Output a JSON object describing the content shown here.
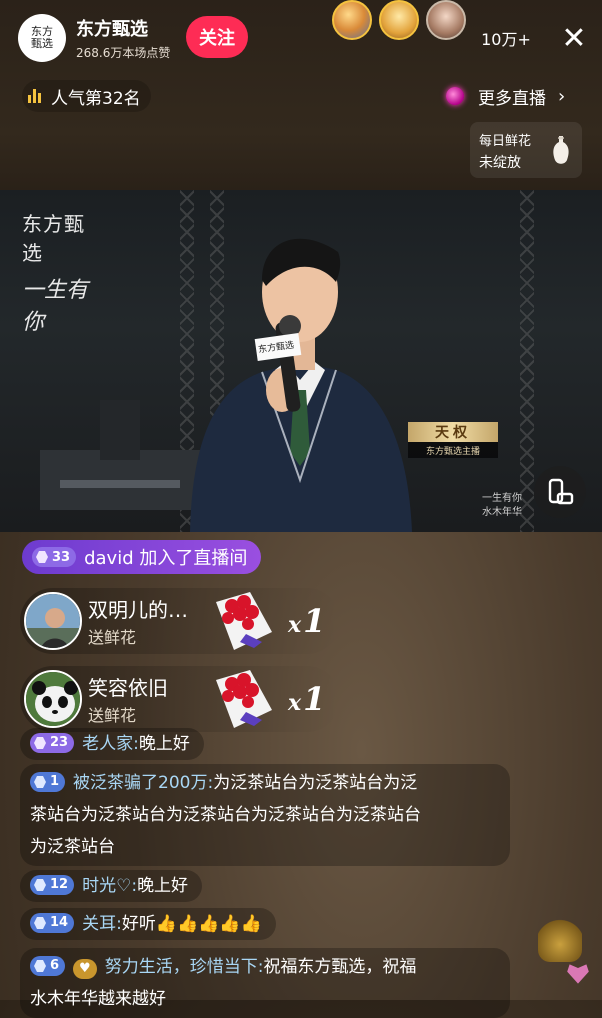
{
  "host": {
    "avatar_text": "东方\n甄选",
    "name": "东方甄选",
    "likes": "268.6万本场点赞",
    "follow_label": "关注"
  },
  "viewers": {
    "count": "10万+"
  },
  "close": {
    "glyph": "✕"
  },
  "popularity": {
    "rank_label": "人气第32名"
  },
  "more_live": {
    "label": "更多直播",
    "chevron": "›"
  },
  "flower_card": {
    "line1": "每日鲜花",
    "line2": "未绽放"
  },
  "video": {
    "logo_brand": "东方甄选",
    "logo_slogan": "一生有你",
    "mic_logo": "东方甄选",
    "nameplate_name": "天权",
    "nameplate_sub": "东方甄选主播",
    "watermark_line1": "一生有你",
    "watermark_line2": "水木年华"
  },
  "join": {
    "level": "33",
    "text": "david 加入了直播间"
  },
  "gifts": [
    {
      "user": "双明儿的…",
      "action": "送鲜花",
      "x": "x",
      "count": "1"
    },
    {
      "user": "笑容依旧",
      "action": "送鲜花",
      "x": "x",
      "count": "1"
    }
  ],
  "comments": [
    {
      "level": "23",
      "user": "老人家:",
      "text": "晚上好"
    },
    {
      "level": "1",
      "user": "被泛茶骗了200万:",
      "line1": "为泛茶站台为泛茶站台为泛",
      "line2": "茶站台为泛茶站台为泛茶站台为泛茶站台为泛茶站台",
      "line3": "为泛茶站台"
    },
    {
      "level": "12",
      "user": "时光♡:",
      "text": "晚上好"
    },
    {
      "level": "14",
      "user": "关耳:",
      "text": "好听👍👍👍👍👍"
    },
    {
      "level": "6",
      "badge": "♥",
      "user": "努力生活，珍惜当下:",
      "line1": "祝福东方甄选，祝福",
      "line2": "水木年华越来越好"
    }
  ]
}
